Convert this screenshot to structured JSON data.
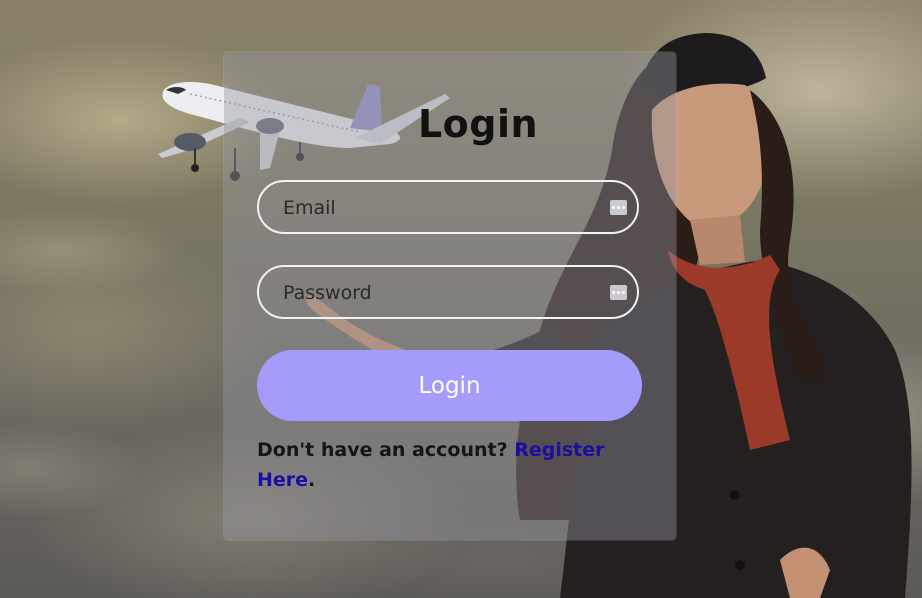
{
  "form": {
    "title": "Login",
    "email_placeholder": "Email",
    "password_placeholder": "Password",
    "login_button": "Login",
    "footer_prompt": "Don't have an account? ",
    "register_link": "Register Here",
    "footer_end": "."
  },
  "icons": {
    "background_plane": "airplane-illustration",
    "background_person": "flight-attendant-photo",
    "field_autofill": "password-manager-key-icon"
  },
  "colors": {
    "login_button_bg": "#a39cfa",
    "login_button_text": "#ffffff",
    "register_link": "#1a0ea0",
    "card_bg": "rgba(150,150,160,0.42)"
  }
}
